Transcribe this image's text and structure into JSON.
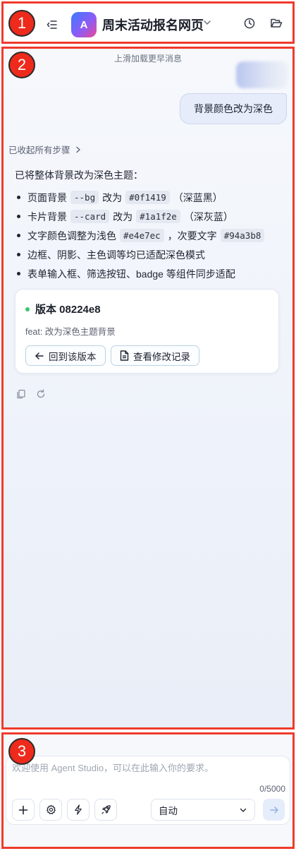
{
  "header": {
    "badge": "1",
    "app_initial": "A",
    "title": "周末活动报名网页"
  },
  "chat": {
    "badge": "2",
    "load_more": "上滑加载更早消息",
    "user_message": "背景颜色改为深色",
    "steps_toggle": "已收起所有步骤",
    "reply_intro": "已将整体背景改为深色主题：",
    "bullets": [
      {
        "t1": "页面背景",
        "c1": "--bg",
        "t2": "改为",
        "c2": "#0f1419",
        "t3": "（深蓝黑）"
      },
      {
        "t1": "卡片背景",
        "c1": "--card",
        "t2": "改为",
        "c2": "#1a1f2e",
        "t3": "（深灰蓝）"
      },
      {
        "t1": "文字颜色调整为浅色",
        "c1": "#e4e7ec",
        "t2": "，次要文字",
        "c2": "#94a3b8",
        "t3": ""
      },
      {
        "t1": "边框、阴影、主色调等均已适配深色模式"
      },
      {
        "t1": "表单输入框、筛选按钮、badge 等组件同步适配"
      }
    ],
    "version": {
      "title": "版本 08224e8",
      "message": "feat: 改为深色主题背景",
      "revert_label": "回到该版本",
      "changes_label": "查看修改记录"
    }
  },
  "composer": {
    "badge": "3",
    "placeholder": "欢迎使用 Agent Studio，可以在此输入你的要求。",
    "char_count": "0/5000",
    "mode_value": "自动"
  },
  "colors": {
    "accent": "#3b7bff",
    "online_dot": "#3cc46a",
    "frame_red": "#ef3b2d"
  }
}
